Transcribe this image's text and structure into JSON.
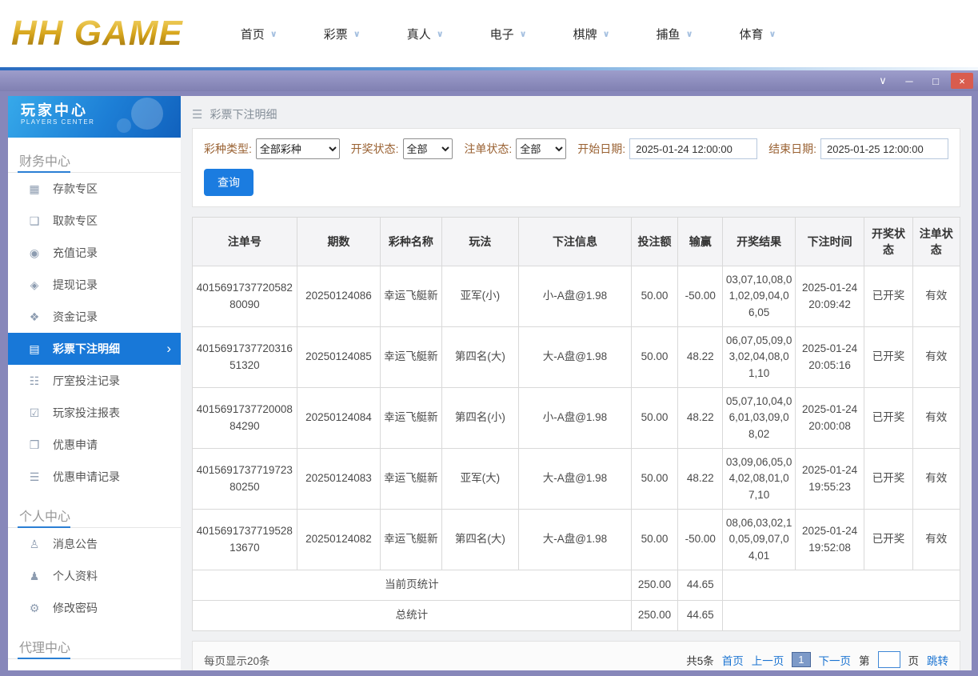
{
  "colors": {
    "accent_blue": "#1878d8",
    "brand_gold": "#d9a81f",
    "titlebar_purple": "#8787ba"
  },
  "topnav": {
    "logo": "HH GAME",
    "chevron": "∨",
    "items": [
      {
        "label": "首页"
      },
      {
        "label": "彩票"
      },
      {
        "label": "真人"
      },
      {
        "label": "电子"
      },
      {
        "label": "棋牌"
      },
      {
        "label": "捕鱼"
      },
      {
        "label": "体育"
      }
    ]
  },
  "titlebar": {
    "controls": {
      "menu": "∨",
      "minimize": "─",
      "maximize": "□",
      "close": "×"
    }
  },
  "sidebar": {
    "title": "玩家中心",
    "subtitle": "PLAYERS CENTER",
    "finance": {
      "header": "财务中心",
      "items": [
        {
          "label": "存款专区",
          "glyph": "▦"
        },
        {
          "label": "取款专区",
          "glyph": "❑"
        },
        {
          "label": "充值记录",
          "glyph": "◉"
        },
        {
          "label": "提现记录",
          "glyph": "◈"
        },
        {
          "label": "资金记录",
          "glyph": "❖"
        },
        {
          "label": "彩票下注明细",
          "glyph": "▤",
          "arrow": "›"
        },
        {
          "label": "厅室投注记录",
          "glyph": "☷"
        },
        {
          "label": "玩家投注报表",
          "glyph": "☑"
        },
        {
          "label": "优惠申请",
          "glyph": "❒"
        },
        {
          "label": "优惠申请记录",
          "glyph": "☰"
        }
      ]
    },
    "personal": {
      "header": "个人中心",
      "items": [
        {
          "label": "消息公告",
          "glyph": "♙"
        },
        {
          "label": "个人资料",
          "glyph": "♟"
        },
        {
          "label": "修改密码",
          "glyph": "⚙"
        }
      ]
    },
    "agent": {
      "header": "代理中心"
    }
  },
  "main": {
    "breadcrumb": {
      "menu_icon": "☰",
      "title": "彩票下注明细"
    },
    "filters": {
      "lottery_type": {
        "label": "彩种类型:",
        "value": "全部彩种"
      },
      "draw_status": {
        "label": "开奖状态:",
        "value": "全部"
      },
      "order_status": {
        "label": "注单状态:",
        "value": "全部"
      },
      "start_date": {
        "label": "开始日期:",
        "value": "2025-01-24 12:00:00"
      },
      "end_date": {
        "label": "结束日期:",
        "value": "2025-01-25 12:00:00"
      },
      "search_label": "查询"
    },
    "table": {
      "headers": [
        "注单号",
        "期数",
        "彩种名称",
        "玩法",
        "下注信息",
        "投注额",
        "输赢",
        "开奖结果",
        "下注时间",
        "开奖状态",
        "注单状态"
      ],
      "rows": [
        {
          "order_id": "401569173772058280090",
          "period": "20250124086",
          "lottery": "幸运飞艇新",
          "play": "亚军(小)",
          "bet_info": "小-A盘@1.98",
          "amount": "50.00",
          "win_loss": "-50.00",
          "result": "03,07,10,08,01,02,09,04,06,05",
          "bet_time": "2025-01-24 20:09:42",
          "draw_status": "已开奖",
          "order_status": "有效"
        },
        {
          "order_id": "401569173772031651320",
          "period": "20250124085",
          "lottery": "幸运飞艇新",
          "play": "第四名(大)",
          "bet_info": "大-A盘@1.98",
          "amount": "50.00",
          "win_loss": "48.22",
          "result": "06,07,05,09,03,02,04,08,01,10",
          "bet_time": "2025-01-24 20:05:16",
          "draw_status": "已开奖",
          "order_status": "有效"
        },
        {
          "order_id": "401569173772000884290",
          "period": "20250124084",
          "lottery": "幸运飞艇新",
          "play": "第四名(小)",
          "bet_info": "小-A盘@1.98",
          "amount": "50.00",
          "win_loss": "48.22",
          "result": "05,07,10,04,06,01,03,09,08,02",
          "bet_time": "2025-01-24 20:00:08",
          "draw_status": "已开奖",
          "order_status": "有效"
        },
        {
          "order_id": "401569173771972380250",
          "period": "20250124083",
          "lottery": "幸运飞艇新",
          "play": "亚军(大)",
          "bet_info": "大-A盘@1.98",
          "amount": "50.00",
          "win_loss": "48.22",
          "result": "03,09,06,05,04,02,08,01,07,10",
          "bet_time": "2025-01-24 19:55:23",
          "draw_status": "已开奖",
          "order_status": "有效"
        },
        {
          "order_id": "401569173771952813670",
          "period": "20250124082",
          "lottery": "幸运飞艇新",
          "play": "第四名(大)",
          "bet_info": "大-A盘@1.98",
          "amount": "50.00",
          "win_loss": "-50.00",
          "result": "08,06,03,02,10,05,09,07,04,01",
          "bet_time": "2025-01-24 19:52:08",
          "draw_status": "已开奖",
          "order_status": "有效"
        }
      ],
      "summary_current": {
        "label": "当前页统计",
        "amount": "250.00",
        "win_loss": "44.65"
      },
      "summary_total": {
        "label": "总统计",
        "amount": "250.00",
        "win_loss": "44.65"
      }
    },
    "pagination": {
      "per_page": "每页显示20条",
      "total": "共5条",
      "first": "首页",
      "prev": "上一页",
      "current_page": "1",
      "next": "下一页",
      "page_prefix": "第",
      "page_suffix": "页",
      "jump": "跳转"
    }
  }
}
